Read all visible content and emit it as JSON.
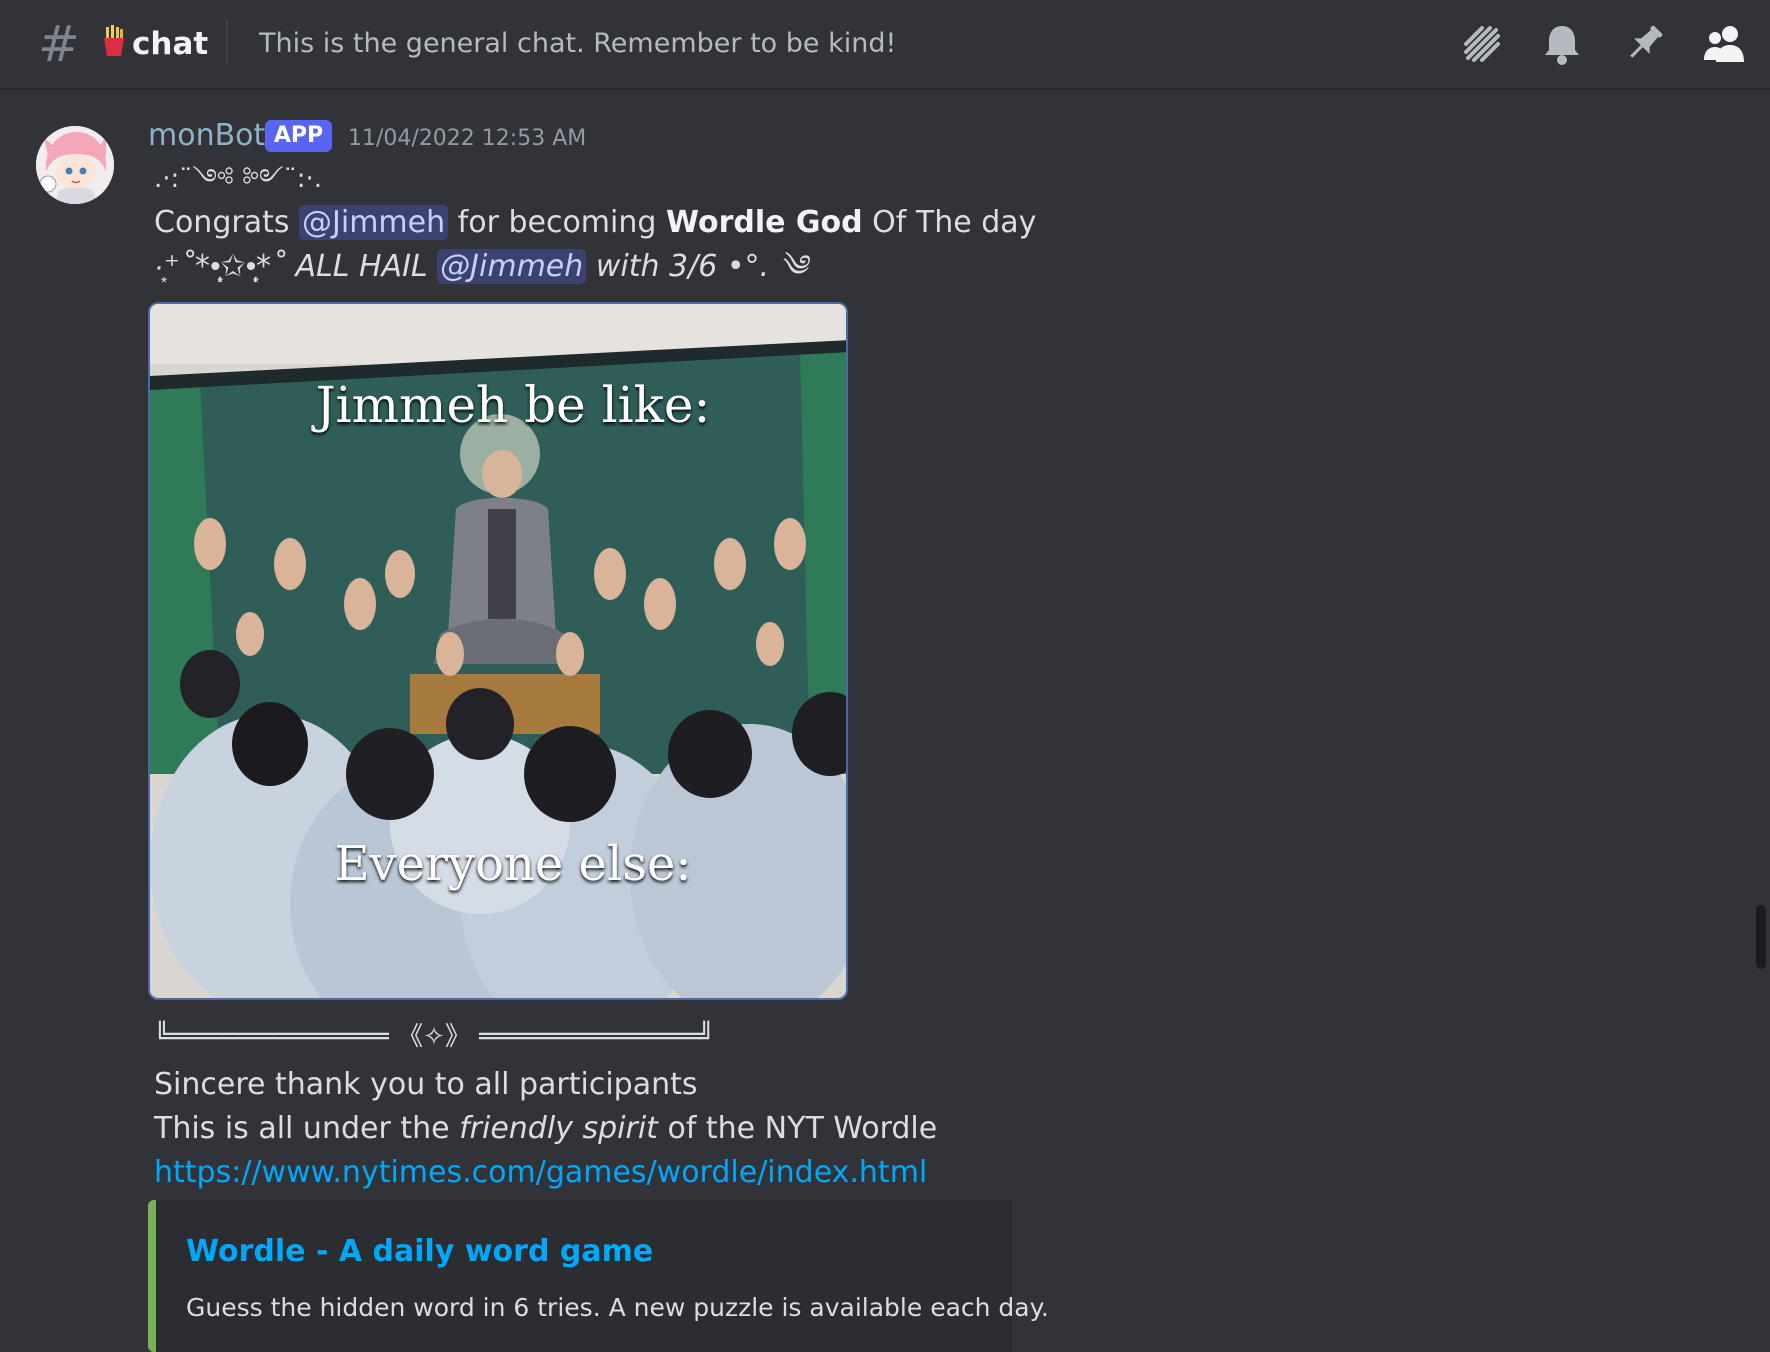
{
  "header": {
    "channel_emoji": "🍟",
    "channel_name": "chat",
    "topic": "This is the general chat. Remember to be kind!",
    "icons": [
      "threads-icon",
      "bell-icon",
      "pin-icon",
      "member-list-icon"
    ]
  },
  "message": {
    "author": "monBot",
    "badge": "APP",
    "timestamp": "11/04/2022 12:53 AM",
    "deco_line": ".·:¨༺ ༻¨:·.",
    "congrats": {
      "prefix": "Congrats ",
      "mention": "@Jimmeh",
      "middle": " for becoming ",
      "bold": "Wordle God",
      "suffix": " Of The day"
    },
    "hail": {
      "prefix": "·͙⁺˚*•̩̩͙✩•̩̩͙*˚ ALL HAIL ",
      "mention": "@Jimmeh",
      "suffix": " with 3/6 •°. ༄"
    },
    "image": {
      "top_text": "Jimmeh be like:",
      "bottom_text": "Everyone else:"
    },
    "separator": "╚══════════════ 《✧》 ══════════════╝",
    "thanks": "Sincere thank you to all participants",
    "spirit": {
      "prefix": "This is all under the ",
      "italic": "friendly spirit",
      "suffix": " of the NYT Wordle"
    },
    "link": "https://www.nytimes.com/games/wordle/index.html",
    "embed": {
      "title": "Wordle - A daily word game",
      "description": "Guess the hidden word in 6 tries. A new puzzle is available each day.",
      "accent_color": "#78b159"
    }
  },
  "colors": {
    "background": "#313338",
    "mention_bg": "#3c4270",
    "link": "#00a8fc",
    "badge": "#5865f2"
  }
}
